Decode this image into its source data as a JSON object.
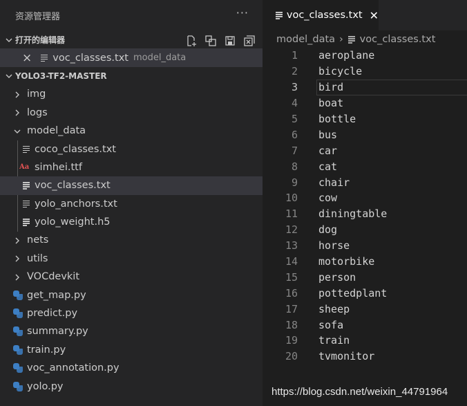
{
  "sidebar": {
    "title": "资源管理器",
    "more_label": "···",
    "open_editors": {
      "title": "打开的编辑器",
      "items": [
        {
          "close": "×",
          "name": "voc_classes.txt",
          "desc": "model_data"
        }
      ]
    },
    "project": {
      "title": "YOLO3-TF2-MASTER",
      "tree": [
        {
          "name": "img",
          "type": "folder"
        },
        {
          "name": "logs",
          "type": "folder"
        },
        {
          "name": "model_data",
          "type": "folder-open"
        },
        {
          "name": "coco_classes.txt",
          "type": "txt"
        },
        {
          "name": "simhei.ttf",
          "type": "font"
        },
        {
          "name": "voc_classes.txt",
          "type": "txt"
        },
        {
          "name": "yolo_anchors.txt",
          "type": "txt"
        },
        {
          "name": "yolo_weight.h5",
          "type": "txt"
        },
        {
          "name": "nets",
          "type": "folder"
        },
        {
          "name": "utils",
          "type": "folder"
        },
        {
          "name": "VOCdevkit",
          "type": "folder"
        },
        {
          "name": "get_map.py",
          "type": "py"
        },
        {
          "name": "predict.py",
          "type": "py"
        },
        {
          "name": "summary.py",
          "type": "py"
        },
        {
          "name": "train.py",
          "type": "py"
        },
        {
          "name": "voc_annotation.py",
          "type": "py"
        },
        {
          "name": "yolo.py",
          "type": "py"
        }
      ]
    },
    "font_icon_glyph": "Aa"
  },
  "editor": {
    "tab": {
      "label": "voc_classes.txt",
      "close": "✕"
    },
    "breadcrumb": {
      "folder": "model_data",
      "sep": "›",
      "file": "voc_classes.txt"
    },
    "current_line": 3,
    "lines": [
      {
        "n": "1",
        "t": "aeroplane"
      },
      {
        "n": "2",
        "t": "bicycle"
      },
      {
        "n": "3",
        "t": "bird"
      },
      {
        "n": "4",
        "t": "boat"
      },
      {
        "n": "5",
        "t": "bottle"
      },
      {
        "n": "6",
        "t": "bus"
      },
      {
        "n": "7",
        "t": "car"
      },
      {
        "n": "8",
        "t": "cat"
      },
      {
        "n": "9",
        "t": "chair"
      },
      {
        "n": "10",
        "t": "cow"
      },
      {
        "n": "11",
        "t": "diningtable"
      },
      {
        "n": "12",
        "t": "dog"
      },
      {
        "n": "13",
        "t": "horse"
      },
      {
        "n": "14",
        "t": "motorbike"
      },
      {
        "n": "15",
        "t": "person"
      },
      {
        "n": "16",
        "t": "pottedplant"
      },
      {
        "n": "17",
        "t": "sheep"
      },
      {
        "n": "18",
        "t": "sofa"
      },
      {
        "n": "19",
        "t": "train"
      },
      {
        "n": "20",
        "t": "tvmonitor"
      }
    ]
  },
  "watermark": "https://blog.csdn.net/weixin_44791964",
  "colors": {
    "sidebar_bg": "#252526",
    "editor_bg": "#1e1e1e",
    "selection_bg": "#37373d",
    "python_icon": "#3d7fc4",
    "font_icon": "#e05252"
  }
}
